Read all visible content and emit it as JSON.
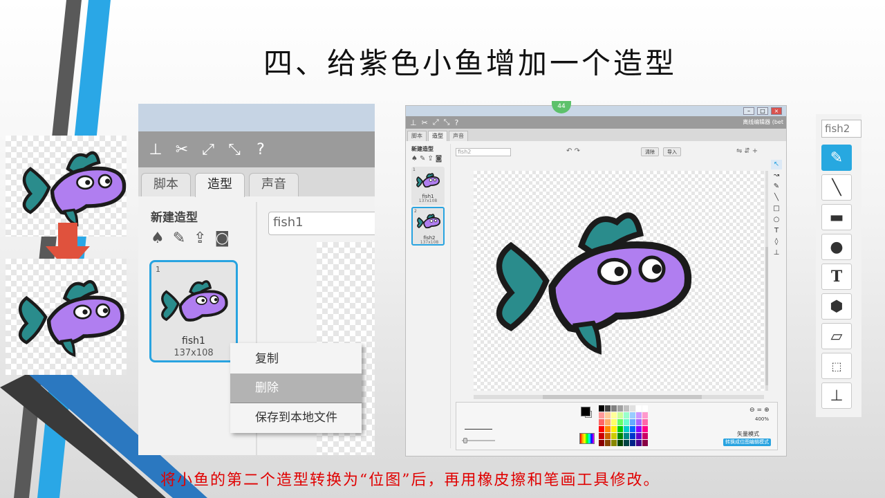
{
  "slide": {
    "title": "四、给紫色小鱼增加一个造型",
    "caption": "将小鱼的第二个造型转换为“位图”后，再用橡皮擦和笔画工具修改。"
  },
  "left_editor": {
    "tabs": [
      "脚本",
      "造型",
      "声音"
    ],
    "active_tab": "造型",
    "new_costume_label": "新建造型",
    "costume_name_value": "fish1",
    "costume": {
      "number": "1",
      "name": "fish1",
      "size": "137x108"
    }
  },
  "context_menu": {
    "items": [
      "复制",
      "删除",
      "保存到本地文件"
    ],
    "highlighted": "删除"
  },
  "right_editor": {
    "badge": "44",
    "app_title": "离线编辑器 (bet",
    "tabs": [
      "脚本",
      "造型",
      "声音"
    ],
    "new_costume_label": "新建造型",
    "costume_name_value": "fish2",
    "clear_label": "清除",
    "import_label": "导入",
    "costumes": [
      {
        "number": "1",
        "name": "fish1",
        "size": "137x108"
      },
      {
        "number": "2",
        "name": "fish2",
        "size": "137x108"
      }
    ],
    "zoom": "400%",
    "mode_label": "矢量模式",
    "convert_button": "转换成位图编辑模式"
  },
  "tool_panel": {
    "name_value": "fish2",
    "tools": [
      "brush-icon",
      "line-icon",
      "rectangle-icon",
      "ellipse-icon",
      "text-icon",
      "fill-icon",
      "eraser-icon",
      "select-icon",
      "stamp-icon"
    ],
    "selected_tool": "brush-icon",
    "text_tool_glyph": "T"
  },
  "colors": {
    "fish_body": "#b07ef0",
    "fish_fin": "#2a8c8c",
    "accent": "#28a3e0",
    "menu_highlight": "#b3b3b3",
    "caption": "#e00000"
  }
}
